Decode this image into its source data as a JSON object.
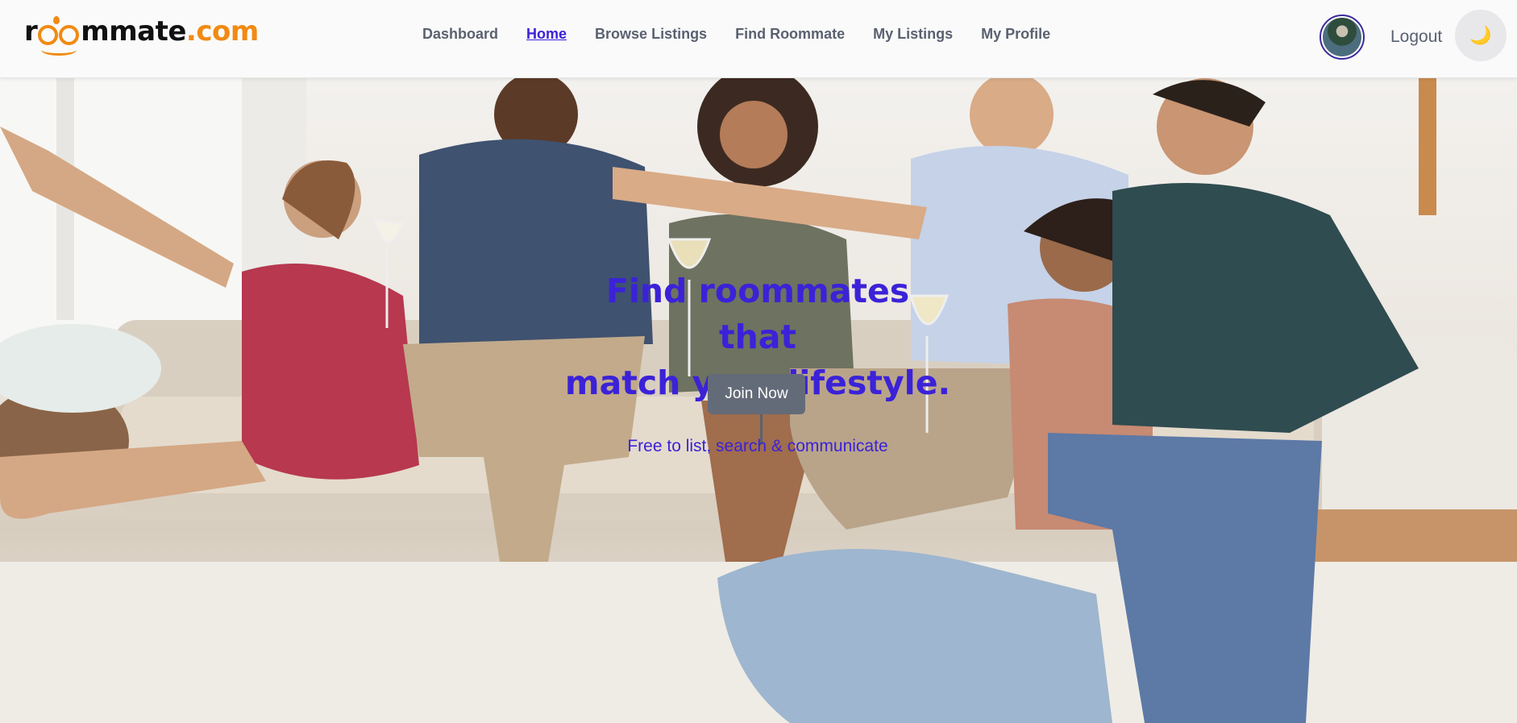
{
  "brand": {
    "part1": "r",
    "part2": "mmate",
    "part3": ".com",
    "brand_color": "#f18a12"
  },
  "nav": {
    "items": [
      {
        "label": "Dashboard",
        "active": false
      },
      {
        "label": "Home",
        "active": true
      },
      {
        "label": "Browse Listings",
        "active": false
      },
      {
        "label": "Find Roommate",
        "active": false
      },
      {
        "label": "My Listings",
        "active": false
      },
      {
        "label": "My Profile",
        "active": false
      }
    ],
    "active_color": "#3b22d8",
    "text_color": "#5a6170"
  },
  "user": {
    "avatar_icon": "avatar-icon",
    "logout_label": "Logout",
    "theme_icon": "moon-icon",
    "theme_glyph": "🌙"
  },
  "hero": {
    "title_line1": "Find roommates that",
    "title_line2": "match your lifestyle.",
    "cta_label": "Join Now",
    "tagline": "Free to list, search & communicate",
    "accent_color": "#3b22d8",
    "background_image": "group of friends on a sofa"
  }
}
